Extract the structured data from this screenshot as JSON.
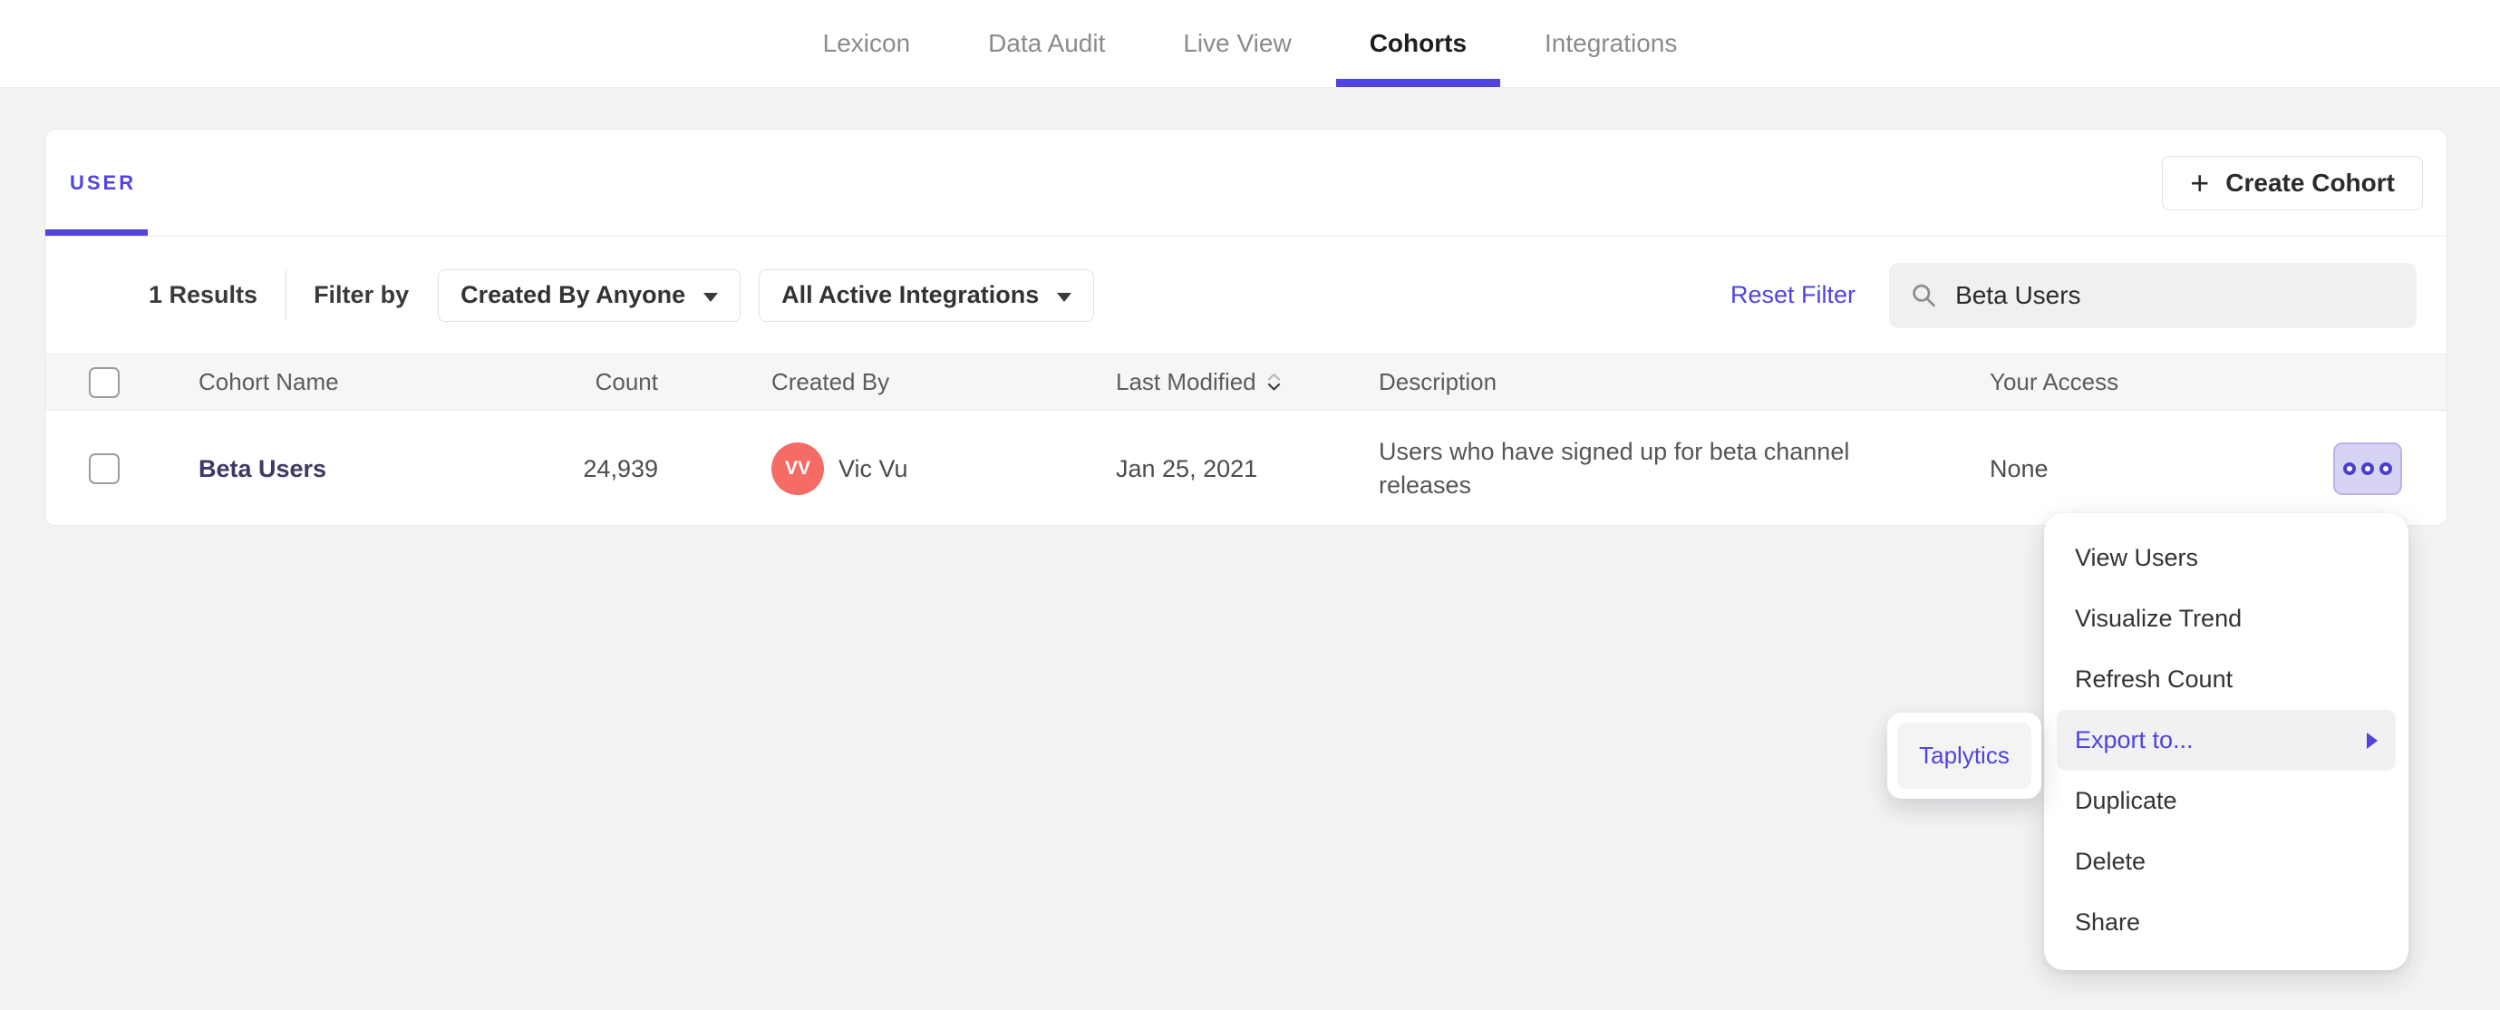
{
  "colors": {
    "accent": "#4f44e0",
    "avatar_bg": "#f56c66",
    "cohort_link": "#3f3963"
  },
  "nav": {
    "tabs": [
      {
        "label": "Lexicon",
        "active": false
      },
      {
        "label": "Data Audit",
        "active": false
      },
      {
        "label": "Live View",
        "active": false
      },
      {
        "label": "Cohorts",
        "active": true
      },
      {
        "label": "Integrations",
        "active": false
      }
    ]
  },
  "panel": {
    "user_tab_label": "USER",
    "create_button_label": "Create Cohort",
    "filters": {
      "results_count": "1 Results",
      "filter_by_label": "Filter by",
      "created_by_dropdown": "Created By Anyone",
      "integrations_dropdown": "All Active Integrations",
      "reset_filter": "Reset Filter",
      "search_value": "Beta Users"
    },
    "table": {
      "headers": [
        "Cohort Name",
        "Count",
        "Created By",
        "Last Modified",
        "Description",
        "Your Access"
      ],
      "rows": [
        {
          "name": "Beta Users",
          "count": "24,939",
          "avatar_initials": "VV",
          "created_by": "Vic Vu",
          "last_modified": "Jan 25, 2021",
          "description": "Users who have signed up for beta channel releases",
          "access": "None"
        }
      ]
    }
  },
  "context_menu": {
    "items": [
      "View Users",
      "Visualize Trend",
      "Refresh Count",
      "Export to...",
      "Duplicate",
      "Delete",
      "Share"
    ],
    "highlighted_item": "Export to...",
    "submenu": {
      "items": [
        "Taplytics"
      ]
    }
  }
}
